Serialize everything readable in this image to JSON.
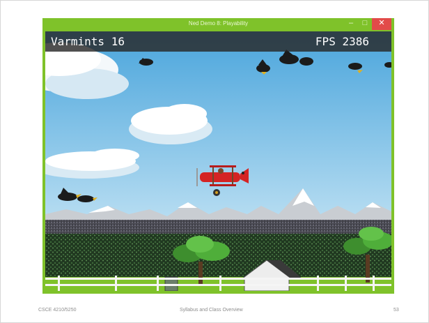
{
  "window": {
    "title": "Ned Demo 8: Playability",
    "minimize_glyph": "–",
    "maximize_glyph": "□",
    "close_glyph": "✕"
  },
  "hud": {
    "score_label": "Varmints",
    "score_value": "16",
    "fps_label": "FPS",
    "fps_value": "2386"
  },
  "footer": {
    "course": "CSCE 4210/5250",
    "topic": "Syllabus and Class Overview",
    "page_number": "53"
  },
  "colors": {
    "window_frame": "#7fc22a",
    "close_button": "#e24b49",
    "sky_top": "#4aa5dc",
    "sky_bottom": "#b9def2",
    "plane": "#d42424"
  }
}
